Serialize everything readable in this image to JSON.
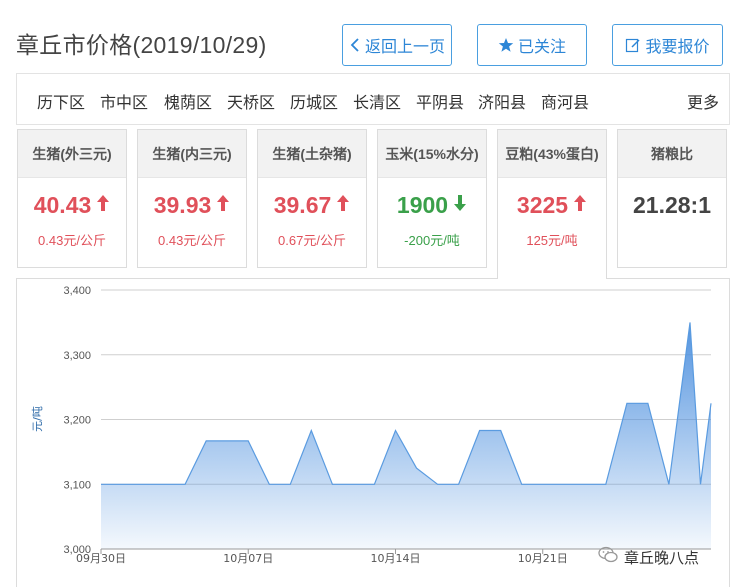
{
  "header": {
    "title": "章丘市价格(2019/10/29)",
    "back_label": "返回上一页",
    "follow_label": "已关注",
    "quote_label": "我要报价"
  },
  "districts": [
    "历下区",
    "市中区",
    "槐荫区",
    "天桥区",
    "历城区",
    "长清区",
    "平阴县",
    "济阳县",
    "商河县"
  ],
  "more_label": "更多",
  "cards": [
    {
      "name": "生猪(外三元)",
      "price": "40.43",
      "trend": "up",
      "change": "0.43元/公斤"
    },
    {
      "name": "生猪(内三元)",
      "price": "39.93",
      "trend": "up",
      "change": "0.43元/公斤"
    },
    {
      "name": "生猪(土杂猪)",
      "price": "39.67",
      "trend": "up",
      "change": "0.67元/公斤"
    },
    {
      "name": "玉米(15%水分)",
      "price": "1900",
      "trend": "down",
      "change": "-200元/吨"
    },
    {
      "name": "豆粕(43%蛋白)",
      "price": "3225",
      "trend": "up",
      "change": "125元/吨"
    },
    {
      "name": "猪粮比",
      "price": "21.28:1",
      "trend": "none",
      "change": ""
    }
  ],
  "active_card": 4,
  "colors": {
    "up": "#e0505a",
    "down": "#3aa04a",
    "accent": "#2d86d6",
    "series": "#5a9be0"
  },
  "icons": {
    "back": "chevron-left-icon",
    "follow": "star-icon",
    "quote": "edit-icon",
    "watermark": "wechat-icon"
  },
  "chart_data": {
    "type": "area",
    "ylabel": "元/吨",
    "ylim": [
      3000,
      3400
    ],
    "yticks": [
      3000,
      3100,
      3200,
      3300,
      3400
    ],
    "ytick_labels": [
      "3,000",
      "3,100",
      "3,200",
      "3,300",
      "3,400"
    ],
    "xlim": [
      "2019-09-30",
      "2019-10-29"
    ],
    "xticks": [
      "2019-09-30",
      "2019-10-07",
      "2019-10-14",
      "2019-10-21"
    ],
    "xtick_labels": [
      "09月30日",
      "10月07日",
      "10月14日",
      "10月21日"
    ],
    "grid": "horizontal",
    "series": [
      {
        "points": [
          [
            "2019-09-30",
            3100
          ],
          [
            "2019-10-04",
            3100
          ],
          [
            "2019-10-05",
            3167
          ],
          [
            "2019-10-07",
            3167
          ],
          [
            "2019-10-08",
            3100
          ],
          [
            "2019-10-09",
            3100
          ],
          [
            "2019-10-10",
            3183
          ],
          [
            "2019-10-11",
            3100
          ],
          [
            "2019-10-13",
            3100
          ],
          [
            "2019-10-14",
            3183
          ],
          [
            "2019-10-15",
            3125
          ],
          [
            "2019-10-16",
            3100
          ],
          [
            "2019-10-17",
            3100
          ],
          [
            "2019-10-18",
            3183
          ],
          [
            "2019-10-19",
            3183
          ],
          [
            "2019-10-20",
            3100
          ],
          [
            "2019-10-24",
            3100
          ],
          [
            "2019-10-25",
            3225
          ],
          [
            "2019-10-26",
            3225
          ],
          [
            "2019-10-27",
            3100
          ],
          [
            "2019-10-28",
            3350
          ],
          [
            "2019-10-28.5",
            3100
          ],
          [
            "2019-10-29",
            3225
          ]
        ]
      }
    ]
  },
  "watermark": "章丘晚八点"
}
